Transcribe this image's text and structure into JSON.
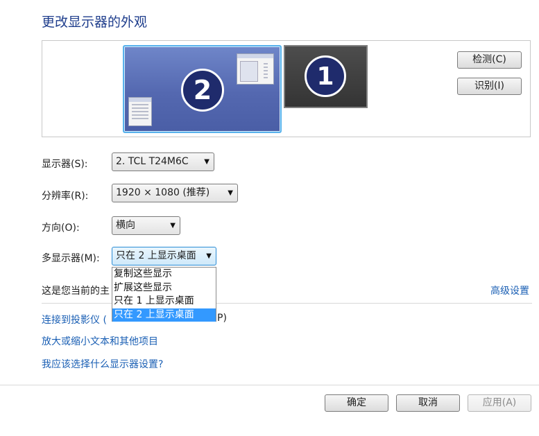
{
  "title": "更改显示器的外观",
  "monitors": [
    {
      "number": "2",
      "selected": true
    },
    {
      "number": "1",
      "selected": false
    }
  ],
  "buttons": {
    "detect": "检测(C)",
    "identify": "识别(I)",
    "ok": "确定",
    "cancel": "取消",
    "apply": "应用(A)"
  },
  "fields": {
    "display_label": "显示器(S):",
    "display_value": "2. TCL T24M6C",
    "resolution_label": "分辨率(R):",
    "resolution_value": "1920 × 1080 (推荐)",
    "orientation_label": "方向(O):",
    "orientation_value": "横向",
    "multi_label": "多显示器(M):",
    "multi_value": "只在 2 上显示桌面"
  },
  "multi_options": [
    "复制这些显示",
    "扩展这些显示",
    "只在 1 上显示桌面",
    "只在 2 上显示桌面"
  ],
  "status_text": "这是您当前的主",
  "advanced_link": "高级设置",
  "links": {
    "projector": "连接到投影仪 (",
    "projector_tail": "P)",
    "text_size": "放大或缩小文本和其他项目",
    "help": "我应该选择什么显示器设置?"
  },
  "colors": {
    "accent": "#3399ff",
    "link": "#1a5fb4",
    "title": "#1e3d8c"
  }
}
